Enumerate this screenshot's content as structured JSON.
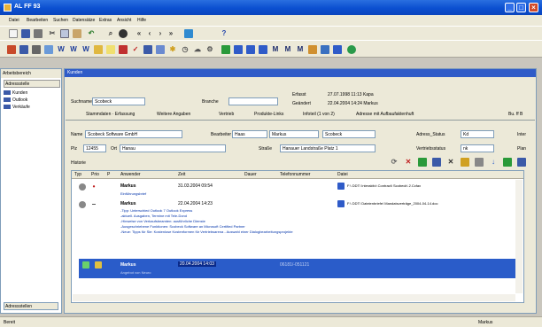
{
  "window": {
    "title": "AL FF 93",
    "buttons": [
      "_",
      "□",
      "×"
    ]
  },
  "menu": [
    "Datei",
    "Bearbeiten",
    "Suchen",
    "Datensätze",
    "Extras",
    "Ansicht",
    "Hilfe"
  ],
  "colors": {
    "title_bar": "#0b4fd0",
    "selection": "#2a5cc9",
    "chrome": "#ece9d8",
    "accent_orange": "#e8a23a"
  },
  "toolbar1_icons": [
    "page-icon",
    "save-icon",
    "print-icon",
    "cut-icon",
    "copy-icon",
    "paste-icon",
    "undo-icon",
    "search-icon",
    "binoculars-icon",
    "first-icon",
    "prev-icon",
    "next-icon",
    "last-icon",
    "chart-icon",
    "help-icon"
  ],
  "toolbar2_icons": [
    "calendar-icon",
    "contacts-icon",
    "phone-icon",
    "task-icon",
    "word-icon",
    "word-icon",
    "word-icon",
    "folder-icon",
    "note-icon",
    "mail-icon",
    "check-icon",
    "report-icon",
    "grid-icon",
    "star-icon",
    "clock-icon",
    "cloud-icon",
    "gear-icon",
    "user-icon",
    "user-icon",
    "user-icon",
    "user-icon",
    "m-icon",
    "m-icon",
    "m-icon",
    "flag-icon",
    "flag-icon",
    "list-icon",
    "globe-icon"
  ],
  "sidebar": {
    "header": "Arbeitsbereich",
    "sub": "Adressstelle",
    "items": [
      "Kunden",
      "Outlook",
      "Verkäufe"
    ],
    "footer": "Adressstellen"
  },
  "main": {
    "header": "Kunden",
    "suchname_label": "Suchname",
    "suchname_value": "Scobeck",
    "branche_label": "Branche",
    "erfasst_label": "Erfasst",
    "erfasst_value": "27.07.1998 11:13 Kapa",
    "geaendert_label": "Geändert",
    "geaendert_value": "22.04.2004 14:24 Markus",
    "tabs": [
      "Stammdaten · Erfassung",
      "Weitere Angaben",
      "Vertrieb",
      "Produkte-Links",
      "Infoteil (1 von 2)",
      "Adresse mit Aufbaufaktenhuft",
      "Bu. ff B"
    ],
    "name_label": "Name",
    "name_value": "Scobeck Software GmbH",
    "bearbeiter_label": "Bearbeiter",
    "bearbeiter_value": "Haas",
    "firma1_value": "Markus",
    "firma2_value": "Scobeck",
    "adress_status_label": "Adress_Status",
    "adress_status_value": "Kd",
    "adress_status_tail": "Inter",
    "plz_label": "Plz",
    "plz_value": "12455",
    "ort_label": "Ort",
    "ort_value": "Hanau",
    "strasse_label": "Straße",
    "strasse_value": "Hanauer Landstraße Platz 1",
    "vertriebsstatus_label": "Vertriebsstatus",
    "vertriebsstatus_value": "nk",
    "vertriebsstatus_tail": "Plan",
    "history_label": "Historie"
  },
  "grid": {
    "headers": [
      "Typ",
      "Prio",
      "P",
      "Anwender",
      "Zeit",
      "Dauer",
      "Telefonnummer",
      "Datei"
    ],
    "rows": [
      {
        "user": "Markus",
        "time": "31.03.2004 09:54",
        "memo": "Einführungsbrief",
        "file": "F:\\ DDT\\ Interaktiv\\ Contract\\ Scobeck\\ 2.Ccfax"
      },
      {
        "user": "Markus",
        "time": "22.04.2004 14:23",
        "memo_lines": [
          "-Tipp: Unterschied Outlook 7 Outlook Express",
          "-aktuell. Ausgaben, Termine mit Tele-Dond",
          "-Hinweise von Verkaufsbeamten: ausführliche Dienste",
          "-Ausgeschriebene Funktionen: Scobeck Software an Microsoft Certified Partner",
          "-Neue: Tipps für Sie: Kostenlose Kostenformen für Vertriebsarena - Auswahl einer Dialogbearbeitungsprojekte"
        ],
        "file": "F:\\ DDT\\ Dateienbriefe\\ Mandatsverträge_2004-04-14.doc"
      },
      {
        "user": "Markus",
        "time": "20.04.2004 14:03",
        "phone": "06181/-051121",
        "memo": "Angebot von Neuro"
      }
    ]
  },
  "status": {
    "left": "Bereit",
    "right": "Markus"
  }
}
